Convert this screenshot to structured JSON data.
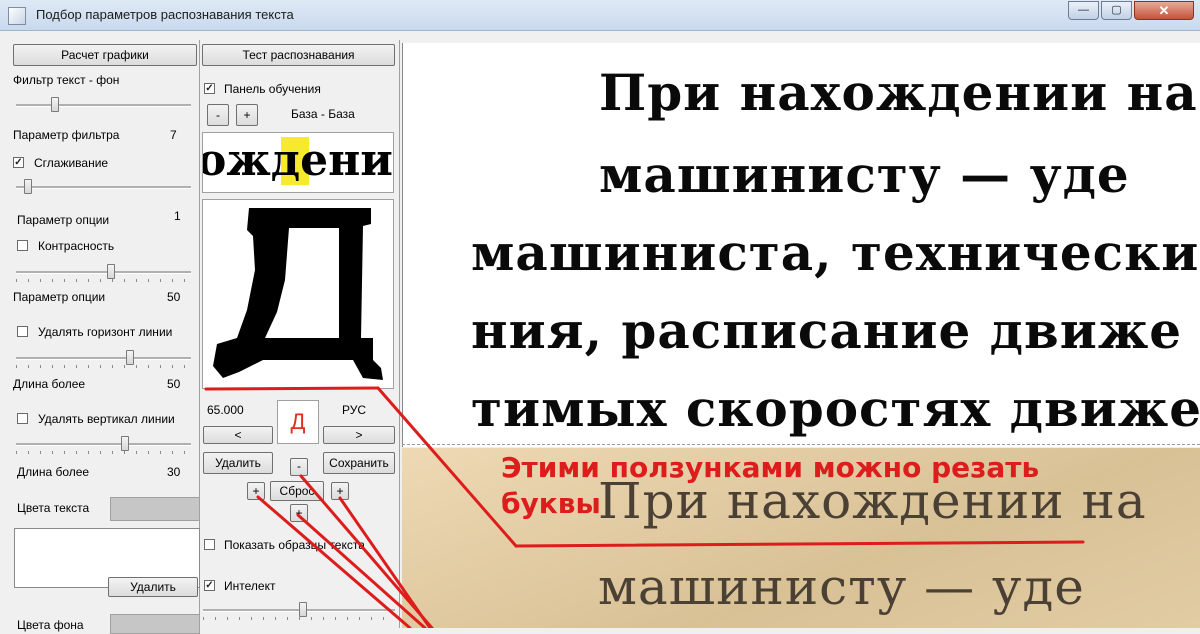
{
  "window": {
    "title": "Подбор параметров распознавания текста",
    "close_glyph": "✕",
    "max_glyph": "▢",
    "min_glyph": "—"
  },
  "left": {
    "calc_button": "Расчет графики",
    "filter_label": "Фильтр текст - фон",
    "filter_param_label": "Параметр фильтра",
    "filter_param_value": "7",
    "smoothing_label": "Сглаживание",
    "smoothing_checked": true,
    "option_param_1_label": "Параметр опции",
    "option_param_1_value": "1",
    "contrast_label": "Контрасность",
    "contrast_checked": false,
    "option_param_2_label": "Параметр опции",
    "option_param_2_value": "50",
    "del_horiz_label": "Удалять горизонт линии",
    "del_horiz_checked": false,
    "length_1_label": "Длина более",
    "length_1_value": "50",
    "del_vert_label": "Удалять вертикал линии",
    "del_vert_checked": false,
    "length_2_label": "Длина более",
    "length_2_value": "30",
    "text_colors_label": "Цвета текста",
    "delete_button": "Удалить",
    "bg_colors_label": "Цвета фона",
    "slider_levels": [
      0.22,
      0.07,
      0.54,
      0.65,
      0.62
    ]
  },
  "middle": {
    "test_button": "Тест распознавания",
    "training_panel_label": "Панель обучения",
    "training_panel_checked": true,
    "minus": "-",
    "plus": "+",
    "base_label": "База - База",
    "preview_text": "ождени",
    "big_letter": "Д",
    "score": "65.000",
    "lang": "РУС",
    "recognized_letter": "Д",
    "prev": "<",
    "next": ">",
    "delete_button": "Удалить",
    "save_button": "Сохранить",
    "reset_button": "Сброс",
    "show_samples_label": "Показать образцы текста",
    "show_samples_checked": false,
    "intellect_label": "Интелект",
    "intellect_checked": true,
    "intellect_level": 0.52
  },
  "document": {
    "clean_lines": [
      "При нахождении на",
      "машинисту — уде",
      "машиниста, технически",
      "ния, расписание движе",
      "тимых скоростях движе"
    ],
    "scan_lines": [
      "При нахождении на",
      "машинисту — уде"
    ]
  },
  "annotation": {
    "line1": "Этими ползунками можно резать",
    "line2": "буквы",
    "color": "#dd1c1c"
  }
}
